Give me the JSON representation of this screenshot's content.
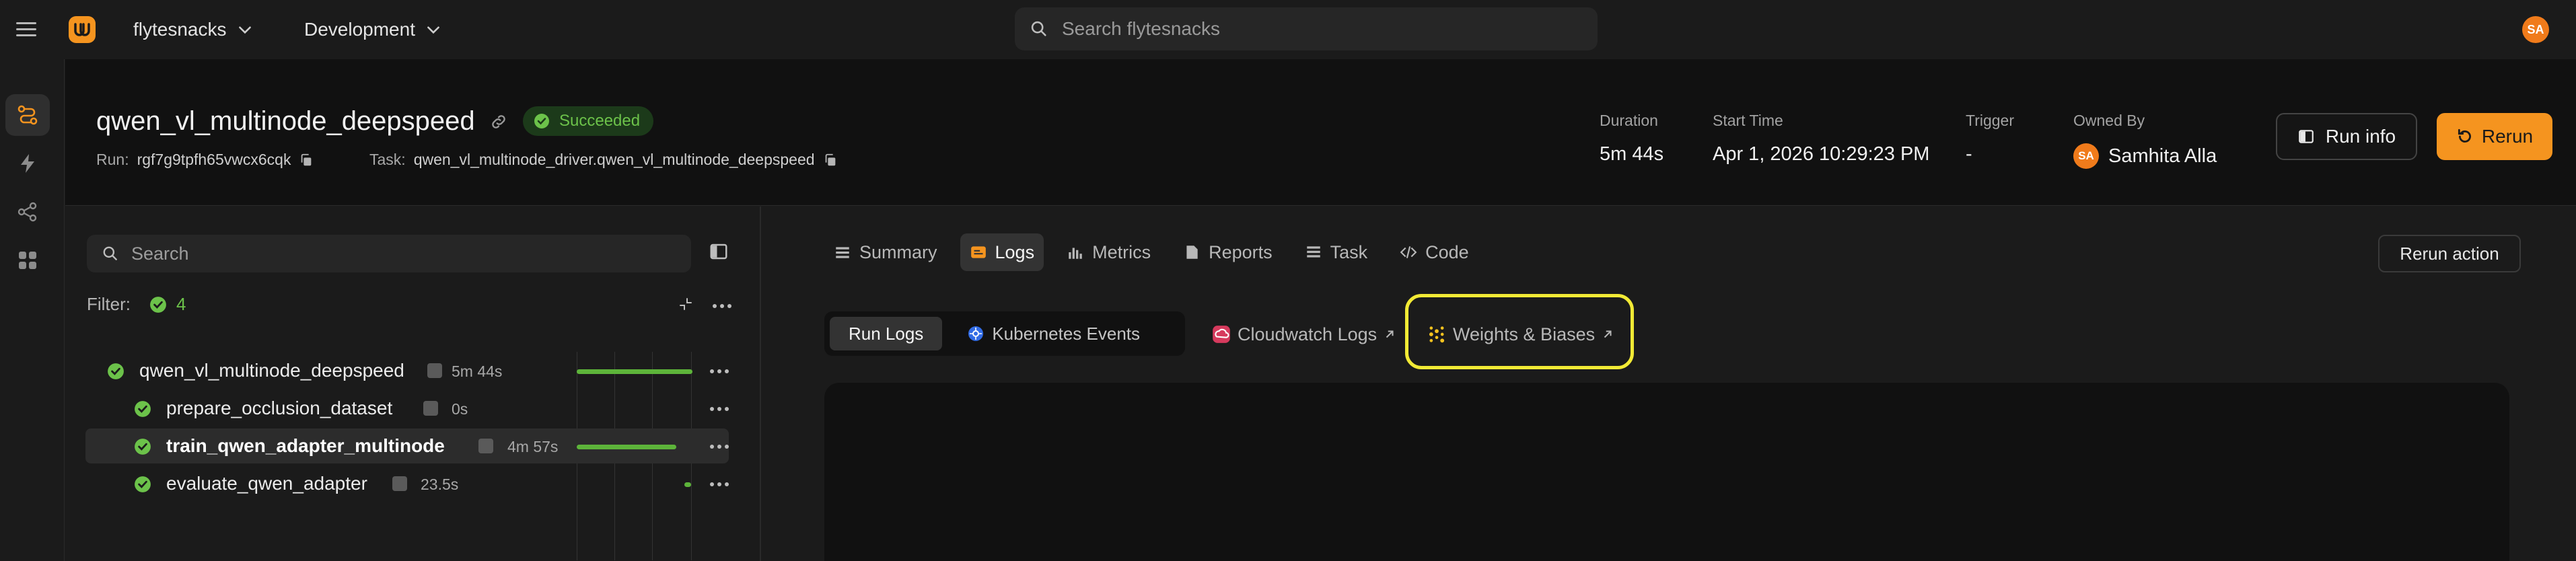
{
  "topbar": {
    "project": "flytesnacks",
    "domain": "Development",
    "search_placeholder": "Search flytesnacks",
    "user_initials": "SA"
  },
  "run": {
    "title": "qwen_vl_multinode_deepspeed",
    "status": "Succeeded",
    "run_label": "Run:",
    "run_id": "rgf7g9tpfh65vwcx6cqk",
    "task_label": "Task:",
    "task_name": "qwen_vl_multinode_driver.qwen_vl_multinode_deepspeed",
    "meta": {
      "duration_label": "Duration",
      "duration": "5m 44s",
      "start_label": "Start Time",
      "start": "Apr 1, 2026 10:29:23 PM",
      "trigger_label": "Trigger",
      "trigger": "-",
      "owner_label": "Owned By",
      "owner": "Samhita Alla",
      "owner_initials": "SA"
    },
    "run_info_label": "Run info",
    "rerun_label": "Rerun"
  },
  "tree": {
    "search_placeholder": "Search",
    "filter_label": "Filter:",
    "filter_count": "4",
    "nodes": [
      {
        "name": "qwen_vl_multinode_deepspeed",
        "duration": "5m 44s",
        "progress": 1.0
      },
      {
        "name": "prepare_occlusion_dataset",
        "duration": "0s",
        "progress": 0.0
      },
      {
        "name": "train_qwen_adapter_multinode",
        "duration": "4m 57s",
        "progress": 0.86
      },
      {
        "name": "evaluate_qwen_adapter",
        "duration": "23.5s",
        "progress": 0.07
      }
    ]
  },
  "tabs": {
    "summary": "Summary",
    "logs": "Logs",
    "metrics": "Metrics",
    "reports": "Reports",
    "task": "Task",
    "code": "Code",
    "rerun_action": "Rerun action"
  },
  "logs": {
    "run_logs": "Run Logs",
    "k8s_events": "Kubernetes Events",
    "cloudwatch": "Cloudwatch Logs",
    "wandb": "Weights & Biases"
  },
  "colors": {
    "accent": "#f5941f",
    "success": "#6cc24a",
    "highlight": "#f2ea35"
  }
}
